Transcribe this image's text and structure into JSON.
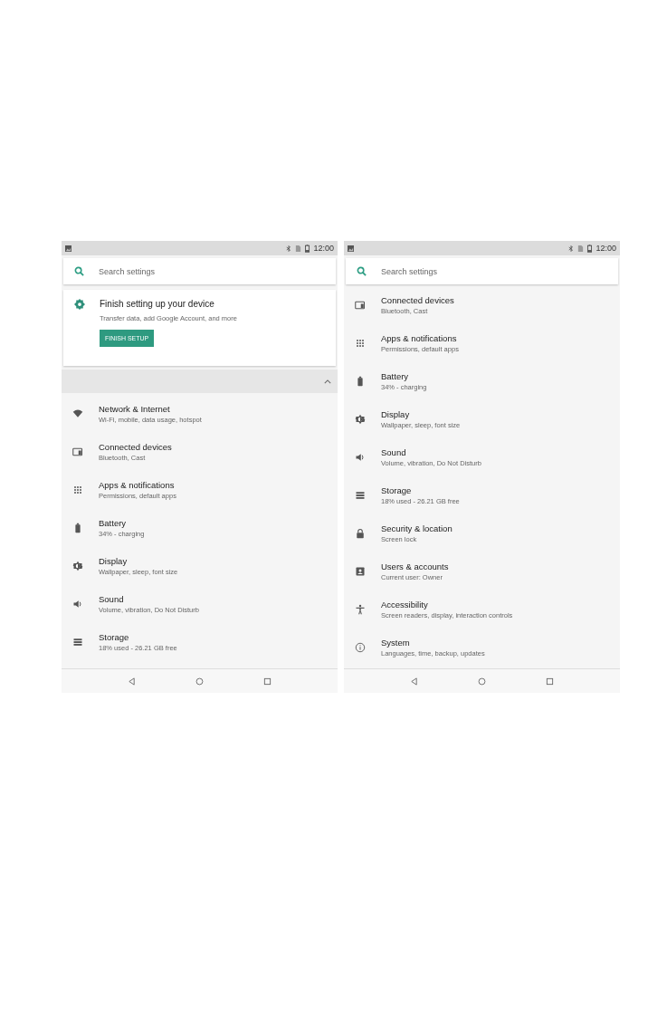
{
  "screens": [
    {
      "status_bar": {
        "time": "12:00"
      },
      "search": {
        "placeholder": "Search settings"
      },
      "setup_card": {
        "title": "Finish setting up your device",
        "subtitle": "Transfer data, add Google Account, and more",
        "button": "FINISH SETUP"
      },
      "items": [
        {
          "kind": "wifi",
          "title": "Network & Internet",
          "subtitle": "Wi-Fi, mobile, data usage, hotspot"
        },
        {
          "kind": "devices",
          "title": "Connected devices",
          "subtitle": "Bluetooth, Cast"
        },
        {
          "kind": "apps",
          "title": "Apps & notifications",
          "subtitle": "Permissions, default apps"
        },
        {
          "kind": "battery",
          "title": "Battery",
          "subtitle": "34% - charging"
        },
        {
          "kind": "display",
          "title": "Display",
          "subtitle": "Wallpaper, sleep, font size"
        },
        {
          "kind": "sound",
          "title": "Sound",
          "subtitle": "Volume, vibration, Do Not Disturb"
        },
        {
          "kind": "storage",
          "title": "Storage",
          "subtitle": "18% used - 26.21 GB free"
        }
      ]
    },
    {
      "status_bar": {
        "time": "12:00"
      },
      "search": {
        "placeholder": "Search settings"
      },
      "items": [
        {
          "kind": "devices",
          "title": "Connected devices",
          "subtitle": "Bluetooth, Cast"
        },
        {
          "kind": "apps",
          "title": "Apps & notifications",
          "subtitle": "Permissions, default apps"
        },
        {
          "kind": "battery",
          "title": "Battery",
          "subtitle": "34% - charging"
        },
        {
          "kind": "display",
          "title": "Display",
          "subtitle": "Wallpaper, sleep, font size"
        },
        {
          "kind": "sound",
          "title": "Sound",
          "subtitle": "Volume, vibration, Do Not Disturb"
        },
        {
          "kind": "storage",
          "title": "Storage",
          "subtitle": "18% used - 26.21 GB free"
        },
        {
          "kind": "security",
          "title": "Security & location",
          "subtitle": "Screen lock"
        },
        {
          "kind": "users",
          "title": "Users & accounts",
          "subtitle": "Current user: Owner"
        },
        {
          "kind": "accessibility",
          "title": "Accessibility",
          "subtitle": "Screen readers, display, interaction controls"
        },
        {
          "kind": "system",
          "title": "System",
          "subtitle": "Languages, time, backup, updates"
        }
      ]
    }
  ]
}
